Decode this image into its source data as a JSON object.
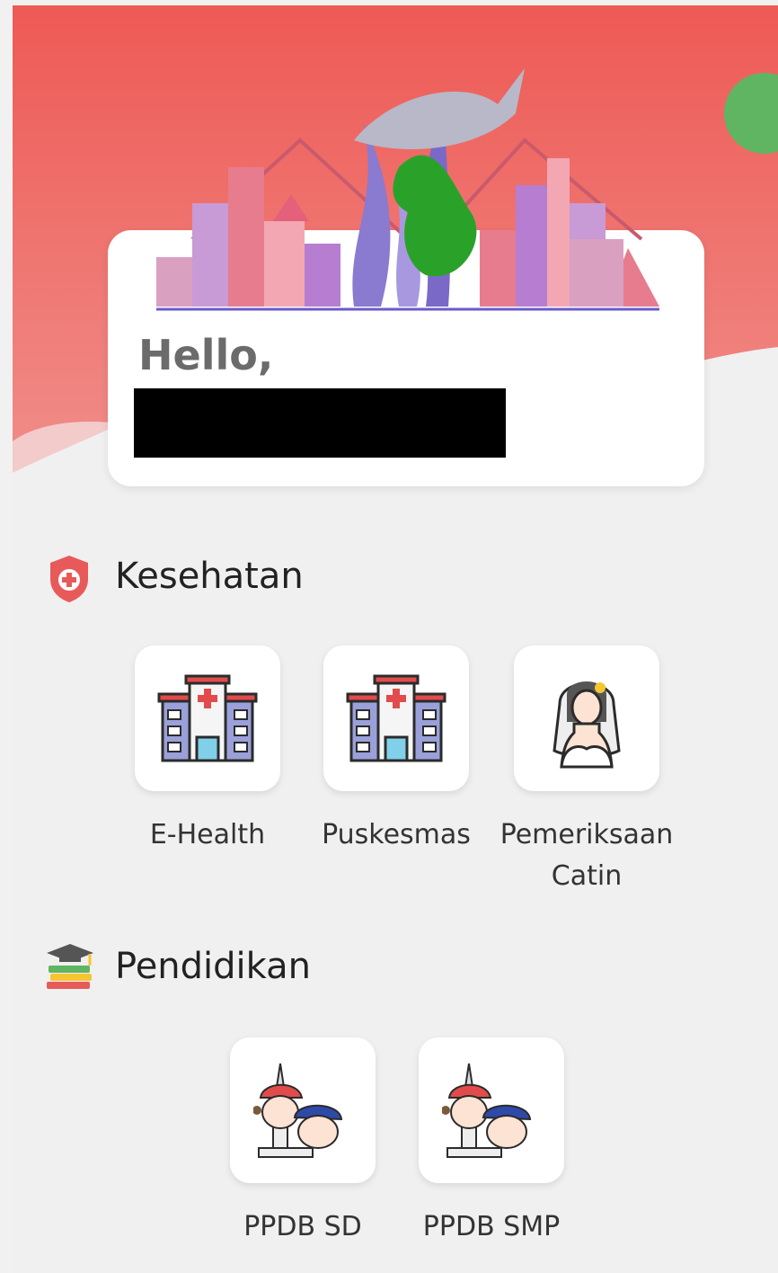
{
  "greeting": {
    "hello": "Hello,"
  },
  "sections": [
    {
      "title": "Kesehatan",
      "icon": "shield-plus-icon",
      "items": [
        {
          "label": "E-Health",
          "icon": "hospital-icon"
        },
        {
          "label": "Puskesmas",
          "icon": "hospital-icon"
        },
        {
          "label": "Pemeriksaan Catin",
          "icon": "bride-icon"
        }
      ]
    },
    {
      "title": "Pendidikan",
      "icon": "books-graduation-cap-icon",
      "items": [
        {
          "label": "PPDB SD",
          "icon": "students-icon"
        },
        {
          "label": "PPDB SMP",
          "icon": "students-icon"
        }
      ]
    }
  ],
  "colors": {
    "header_red": "#ee5a55",
    "fab_green": "#5fb562",
    "background": "#f0f0f0"
  }
}
